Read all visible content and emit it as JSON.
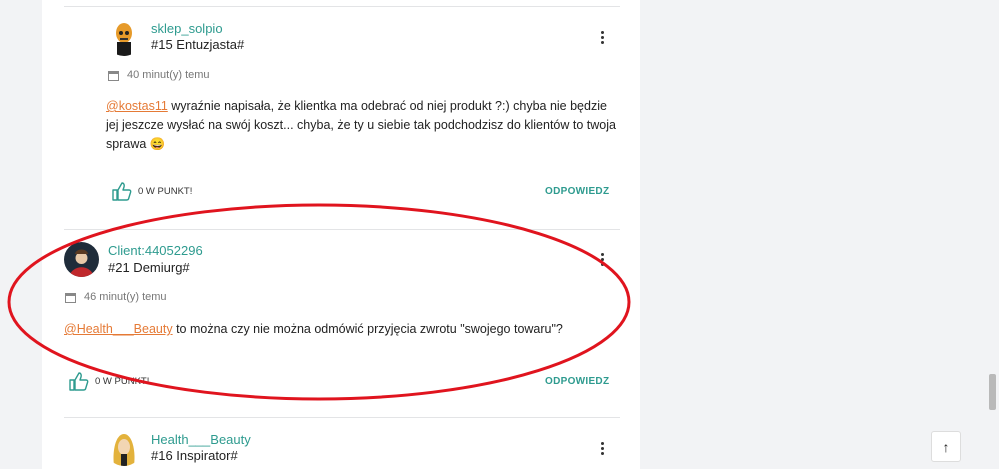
{
  "posts": [
    {
      "username": "sklep_solpio",
      "rank": "#15 Entuzjasta#",
      "time": "40 minut(y) temu",
      "mention": "@kostas11",
      "text": " wyraźnie napisała, że klientka ma odebrać od niej produkt ?:) chyba nie będzie jej jeszcze wysłać na swój koszt... chyba, że ty u siebie tak podchodzisz do klientów to twoja sprawa ",
      "emoji": "😄",
      "likes": "0 W PUNKT!",
      "reply": "ODPOWIEDZ"
    },
    {
      "username": "Client:44052296",
      "rank": "#21 Demiurg#",
      "time": "46 minut(y) temu",
      "mention": "@Health___Beauty",
      "text": " to można czy nie można odmówić przyjęcia zwrotu \"swojego towaru\"?",
      "likes": "0 W PUNKT!",
      "reply": "ODPOWIEDZ"
    },
    {
      "username": "Health___Beauty",
      "rank": "#16 Inspirator#"
    }
  ],
  "scroll_top_icon": "↑",
  "colors": {
    "accent": "#2e9b8f",
    "mention": "#e57a36",
    "annotation": "#e0141e"
  }
}
